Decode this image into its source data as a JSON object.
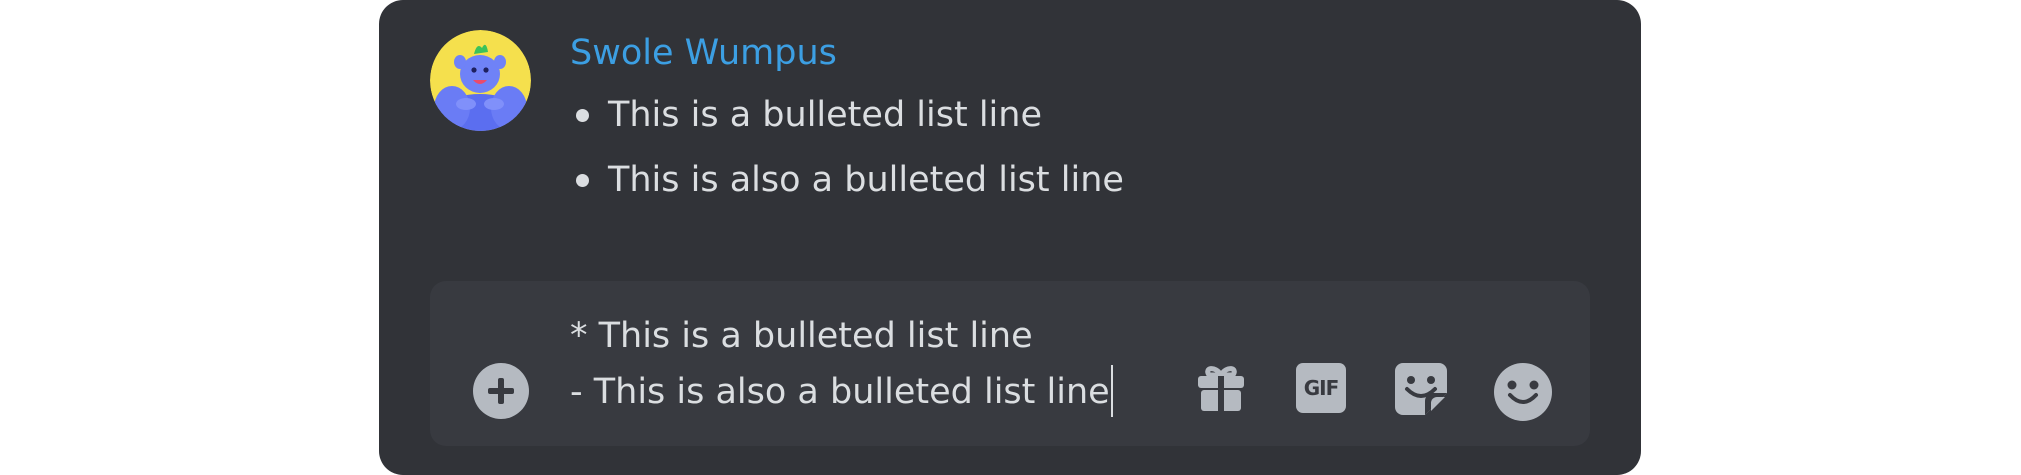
{
  "message": {
    "username": "Swole Wumpus",
    "username_color": "#3c9fe3",
    "avatar": "wumpus-avatar",
    "bullets": [
      "This is a bulleted list line",
      "This is also a bulleted list line"
    ]
  },
  "composer": {
    "lines": [
      "* This is a bulleted list line",
      "- This is also a bulleted list line"
    ],
    "gif_label": "GIF",
    "icons": [
      "plus-icon",
      "gift-icon",
      "gif-icon",
      "sticker-icon",
      "emoji-icon"
    ]
  },
  "colors": {
    "panel_bg": "#313338",
    "composer_bg": "#383a40",
    "text": "#dbdee1",
    "icon": "#b5bac1"
  }
}
